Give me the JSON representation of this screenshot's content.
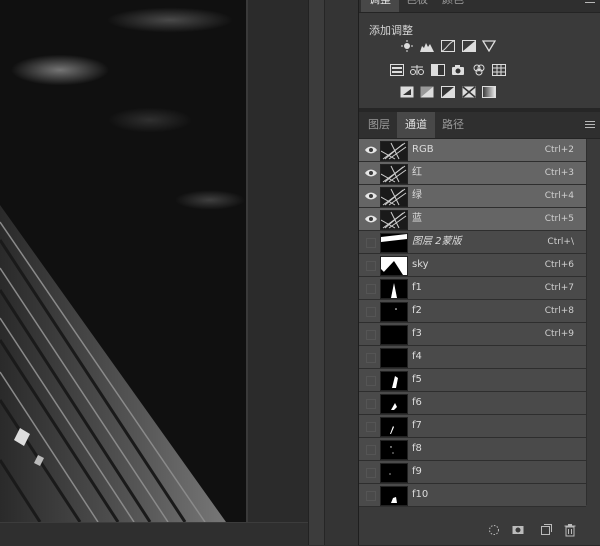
{
  "adjust_panel": {
    "tabs": [
      {
        "label": "调整",
        "active": true
      },
      {
        "label": "色板",
        "active": false
      },
      {
        "label": "颜色",
        "active": false
      }
    ],
    "title": "添加调整",
    "row1_icons": [
      "brightness-contrast-icon",
      "levels-icon",
      "curves-icon",
      "exposure-icon",
      "vibrance-icon"
    ],
    "row2_icons": [
      "hue-saturation-icon",
      "color-balance-icon",
      "black-white-icon",
      "photo-filter-icon",
      "channel-mixer-icon",
      "color-lookup-icon"
    ],
    "row3_icons": [
      "invert-icon",
      "posterize-icon",
      "threshold-icon",
      "selective-color-icon",
      "gradient-map-icon"
    ]
  },
  "channels_panel": {
    "tabs": [
      {
        "label": "图层",
        "active": false
      },
      {
        "label": "通道",
        "active": true
      },
      {
        "label": "路径",
        "active": false
      }
    ],
    "rows": [
      {
        "name": "RGB",
        "shortcut": "Ctrl+2",
        "visible": true,
        "selected": true,
        "thumb": "composite"
      },
      {
        "name": "红",
        "shortcut": "Ctrl+3",
        "visible": true,
        "selected": true,
        "thumb": "composite"
      },
      {
        "name": "绿",
        "shortcut": "Ctrl+4",
        "visible": true,
        "selected": true,
        "thumb": "composite"
      },
      {
        "name": "蓝",
        "shortcut": "Ctrl+5",
        "visible": true,
        "selected": true,
        "thumb": "composite"
      },
      {
        "name": "图层 2蒙版",
        "shortcut": "Ctrl+\\",
        "visible": false,
        "selected": false,
        "thumb": "mask-stripe",
        "italic": true
      },
      {
        "name": "sky",
        "shortcut": "Ctrl+6",
        "visible": false,
        "selected": false,
        "thumb": "sky"
      },
      {
        "name": "f1",
        "shortcut": "Ctrl+7",
        "visible": false,
        "selected": false,
        "thumb": "spike"
      },
      {
        "name": "f2",
        "shortcut": "Ctrl+8",
        "visible": false,
        "selected": false,
        "thumb": "dot"
      },
      {
        "name": "f3",
        "shortcut": "Ctrl+9",
        "visible": false,
        "selected": false,
        "thumb": "black"
      },
      {
        "name": "f4",
        "shortcut": "",
        "visible": false,
        "selected": false,
        "thumb": "black"
      },
      {
        "name": "f5",
        "shortcut": "",
        "visible": false,
        "selected": false,
        "thumb": "blob"
      },
      {
        "name": "f6",
        "shortcut": "",
        "visible": false,
        "selected": false,
        "thumb": "blob-small"
      },
      {
        "name": "f7",
        "shortcut": "",
        "visible": false,
        "selected": false,
        "thumb": "sliver"
      },
      {
        "name": "f8",
        "shortcut": "",
        "visible": false,
        "selected": false,
        "thumb": "dots"
      },
      {
        "name": "f9",
        "shortcut": "",
        "visible": false,
        "selected": false,
        "thumb": "tiny"
      },
      {
        "name": "f10",
        "shortcut": "",
        "visible": false,
        "selected": false,
        "thumb": "blob-bottom"
      }
    ],
    "bottom_icons": [
      "load-selection-icon",
      "save-selection-icon",
      "new-channel-icon",
      "delete-channel-icon"
    ]
  },
  "colors": {
    "accent": "#656565",
    "panel": "#3a3a3a",
    "row": "#4a4a4a"
  }
}
